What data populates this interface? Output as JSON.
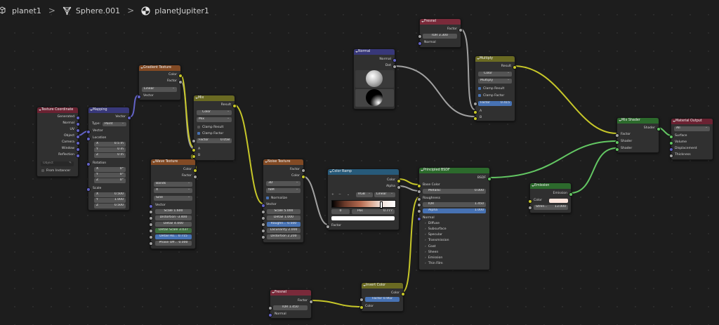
{
  "breadcrumb": {
    "items": [
      "planet1",
      "Sphere.001",
      "planetJupiter1"
    ],
    "separator": ">"
  },
  "nodes": {
    "texcoord": {
      "title": "Texture Coordinate",
      "outputs": [
        "Generated",
        "Normal",
        "UV",
        "Object",
        "Camera",
        "Window",
        "Reflection"
      ],
      "object_placeholder": "Object",
      "from_instancer": "From Instancer"
    },
    "mapping": {
      "title": "Mapping",
      "out_vector": "Vector",
      "type_label": "Type:",
      "type_value": "Point",
      "in_vector": "Vector",
      "location_label": "Location",
      "location": [
        {
          "l": "X",
          "v": "0.5 m"
        },
        {
          "l": "Y",
          "v": "0 m"
        },
        {
          "l": "Z",
          "v": "0 m"
        }
      ],
      "rotation_label": "Rotation",
      "rotation": [
        {
          "l": "X",
          "v": "0°"
        },
        {
          "l": "Y",
          "v": "0°"
        },
        {
          "l": "Z",
          "v": "0°"
        }
      ],
      "scale_label": "Scale",
      "scale": [
        {
          "l": "X",
          "v": "0.500"
        },
        {
          "l": "Y",
          "v": "1.000"
        },
        {
          "l": "Z",
          "v": "0.500"
        }
      ]
    },
    "gradient": {
      "title": "Gradient Texture",
      "out_color": "Color",
      "out_factor": "Factor",
      "type": "Linear",
      "in_vector": "Vector"
    },
    "mix": {
      "title": "Mix",
      "out_result": "Result",
      "data_type": "Color",
      "blend": "Mix",
      "clamp_result": "Clamp Result",
      "clamp_factor": "Clamp Factor",
      "factor_label": "Factor",
      "factor_value": "0.058",
      "in_a": "A",
      "in_b": "B"
    },
    "wave": {
      "title": "Wave Texture",
      "out_color": "Color",
      "out_factor": "Factor",
      "type": "Bands",
      "direction": "X",
      "profile": "Sine",
      "in_vector": "Vector",
      "fields": [
        {
          "l": "Scale",
          "v": "1.600"
        },
        {
          "l": "Distortion",
          "v": "-3.400"
        },
        {
          "l": "Detail",
          "v": "4.000"
        },
        {
          "l": "Detail Scale",
          "v": "3.037"
        },
        {
          "l": "Detail Ro...",
          "v": "0.715"
        },
        {
          "l": "Phase Off...",
          "v": "0.000"
        }
      ]
    },
    "noise": {
      "title": "Noise Texture",
      "out_factor": "Factor",
      "out_color": "Color",
      "dimensions": "3D",
      "type": "fBM",
      "normalize": "Normalize",
      "in_vector": "Vector",
      "fields": [
        {
          "l": "Scale",
          "v": "5.000"
        },
        {
          "l": "Detail",
          "v": "1.000"
        },
        {
          "l": "Roughn...",
          "v": "0.500"
        },
        {
          "l": "Lacunarity",
          "v": "2.000"
        },
        {
          "l": "Distortion",
          "v": "2.200"
        }
      ]
    },
    "colorramp": {
      "title": "Color Ramp",
      "out_color": "Color",
      "out_alpha": "Alpha",
      "btn_add": "+",
      "btn_remove": "−",
      "color_mode": "RGB",
      "interpolation": "Linear",
      "stop_index": "0",
      "pos_label": "Pos",
      "pos_value": "0.777",
      "in_factor": "Factor"
    },
    "normal": {
      "title": "Normal",
      "out_normal": "Normal",
      "out_dot": "Dot"
    },
    "fresnel_top": {
      "title": "Fresnel",
      "out_factor": "Factor",
      "ior_label": "IOR",
      "ior_value": "3.300",
      "in_normal": "Normal"
    },
    "multiply": {
      "title": "Multiply",
      "out_result": "Result",
      "data_type": "Color",
      "blend": "Multiply",
      "clamp_result": "Clamp Result",
      "clamp_factor": "Clamp Factor",
      "factor_label": "Factor",
      "factor_value": "0.415",
      "in_a": "A",
      "in_b": "B"
    },
    "bsdf": {
      "title": "Principled BSDF",
      "out_bsdf": "BSDF",
      "base_color": "Base Color",
      "metallic_label": "Metallic",
      "metallic_value": "0.000",
      "roughness": "Roughness",
      "ior_label": "IOR",
      "ior_value": "1.450",
      "alpha_label": "Alpha",
      "alpha_value": "1.000",
      "normal": "Normal",
      "panels": [
        "Diffuse",
        "Subsurface",
        "Specular",
        "Transmission",
        "Coat",
        "Sheen",
        "Emission",
        "Thin Film"
      ]
    },
    "mixshader": {
      "title": "Mix Shader",
      "out_shader": "Shader",
      "in_factor": "Factor",
      "in_shader1": "Shader",
      "in_shader2": "Shader"
    },
    "output": {
      "title": "Material Output",
      "target": "All",
      "in_surface": "Surface",
      "in_volume": "Volume",
      "in_displacement": "Displacement",
      "in_thickness": "Thickness"
    },
    "emission": {
      "title": "Emission",
      "out_emission": "Emission",
      "color_label": "Color",
      "strength_label": "Stren...",
      "strength_value": "13.000"
    },
    "fresnel_bottom": {
      "title": "Fresnel",
      "out_factor": "Factor",
      "ior_label": "IOR",
      "ior_value": "1.450",
      "in_normal": "Normal"
    },
    "invert": {
      "title": "Invert Color",
      "out_color": "Color",
      "factor_label": "Factor",
      "factor_value": "0.902",
      "in_color": "Color"
    }
  },
  "colors": {
    "wire_color": "#c7c729",
    "wire_float": "#a1a1a1",
    "wire_vector": "#6363c7",
    "wire_shader": "#63c763",
    "header_texture": "#824a24",
    "header_input": "#7a2a3a",
    "header_vector": "#38387a",
    "header_converter": "#275a7a",
    "header_shader": "#2c6a2c",
    "header_color": "#6a6a22"
  }
}
